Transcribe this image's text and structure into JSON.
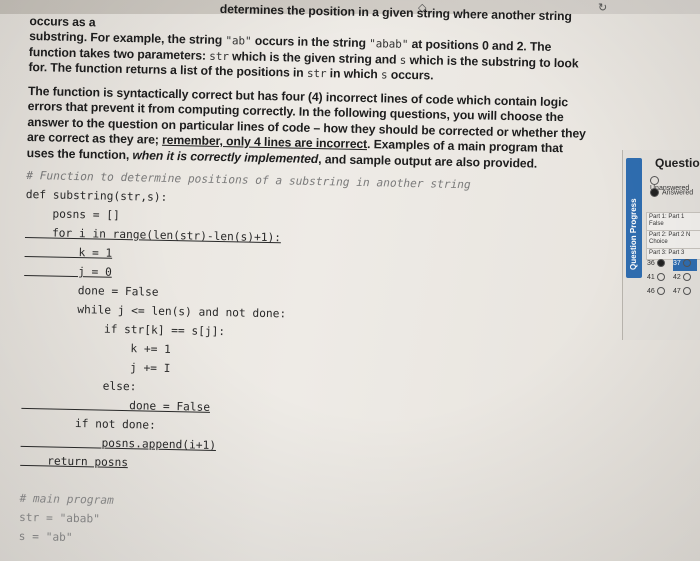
{
  "intro": {
    "p1": {
      "a": "substring. For example, the string ",
      "ex1": "\"ab\"",
      "b": " occurs in the string ",
      "ex2": "\"abab\"",
      "c": " at positions 0 and 2. The function takes two parameters: ",
      "p_str": "str",
      "d": " which is the given string and ",
      "p_s": "s",
      "e": " which is the substring to look for. The function returns a list of the positions in ",
      "p_str2": "str",
      "f": " in which ",
      "p_s2": "s",
      "g": " occurs.",
      "head": "determines the position in a given string where another string occurs as a"
    },
    "p2": {
      "a": "The function is syntactically correct but has four (4) incorrect lines of code which contain logic errors that prevent it from computing correctly. In the following questions, you will choose the answer to the question on particular lines of code – how they should be corrected or whether they are correct as they are; ",
      "u": "remember, only 4 lines are incorrect",
      "b": ". Examples of a main program that uses the function, ",
      "em": "when it is correctly implemented",
      "c": ", and sample output are also provided."
    }
  },
  "code": [
    "# Function to determine positions of a substring in another string",
    "def substring(str,s):",
    "    posns = []",
    "    for i in range(len(str)-len(s)+1):",
    "        k = 1",
    "        j = 0",
    "        done = False",
    "        while j <= len(s) and not done:",
    "            if str[k] == s[j]:",
    "                k += 1",
    "                j += I",
    "            else:",
    "                done = False",
    "        if not done:",
    "            posns.append(i+1)",
    "    return posns",
    "",
    "# main program",
    "str = \"abab\"",
    "s = \"ab\""
  ],
  "panel": {
    "title": "Question",
    "tab_label": "Question Progress",
    "legend_unanswered": "Unanswered",
    "legend_answered": "Answered",
    "parts": [
      {
        "label": "Part 1: Part 1",
        "type": "False"
      },
      {
        "label": "Part 2: Part 2 N",
        "type": "Choice"
      },
      {
        "label": "Part 3: Part 3",
        "type": ""
      }
    ],
    "questions": [
      "36",
      "37",
      "41",
      "42",
      "46",
      "47"
    ]
  }
}
